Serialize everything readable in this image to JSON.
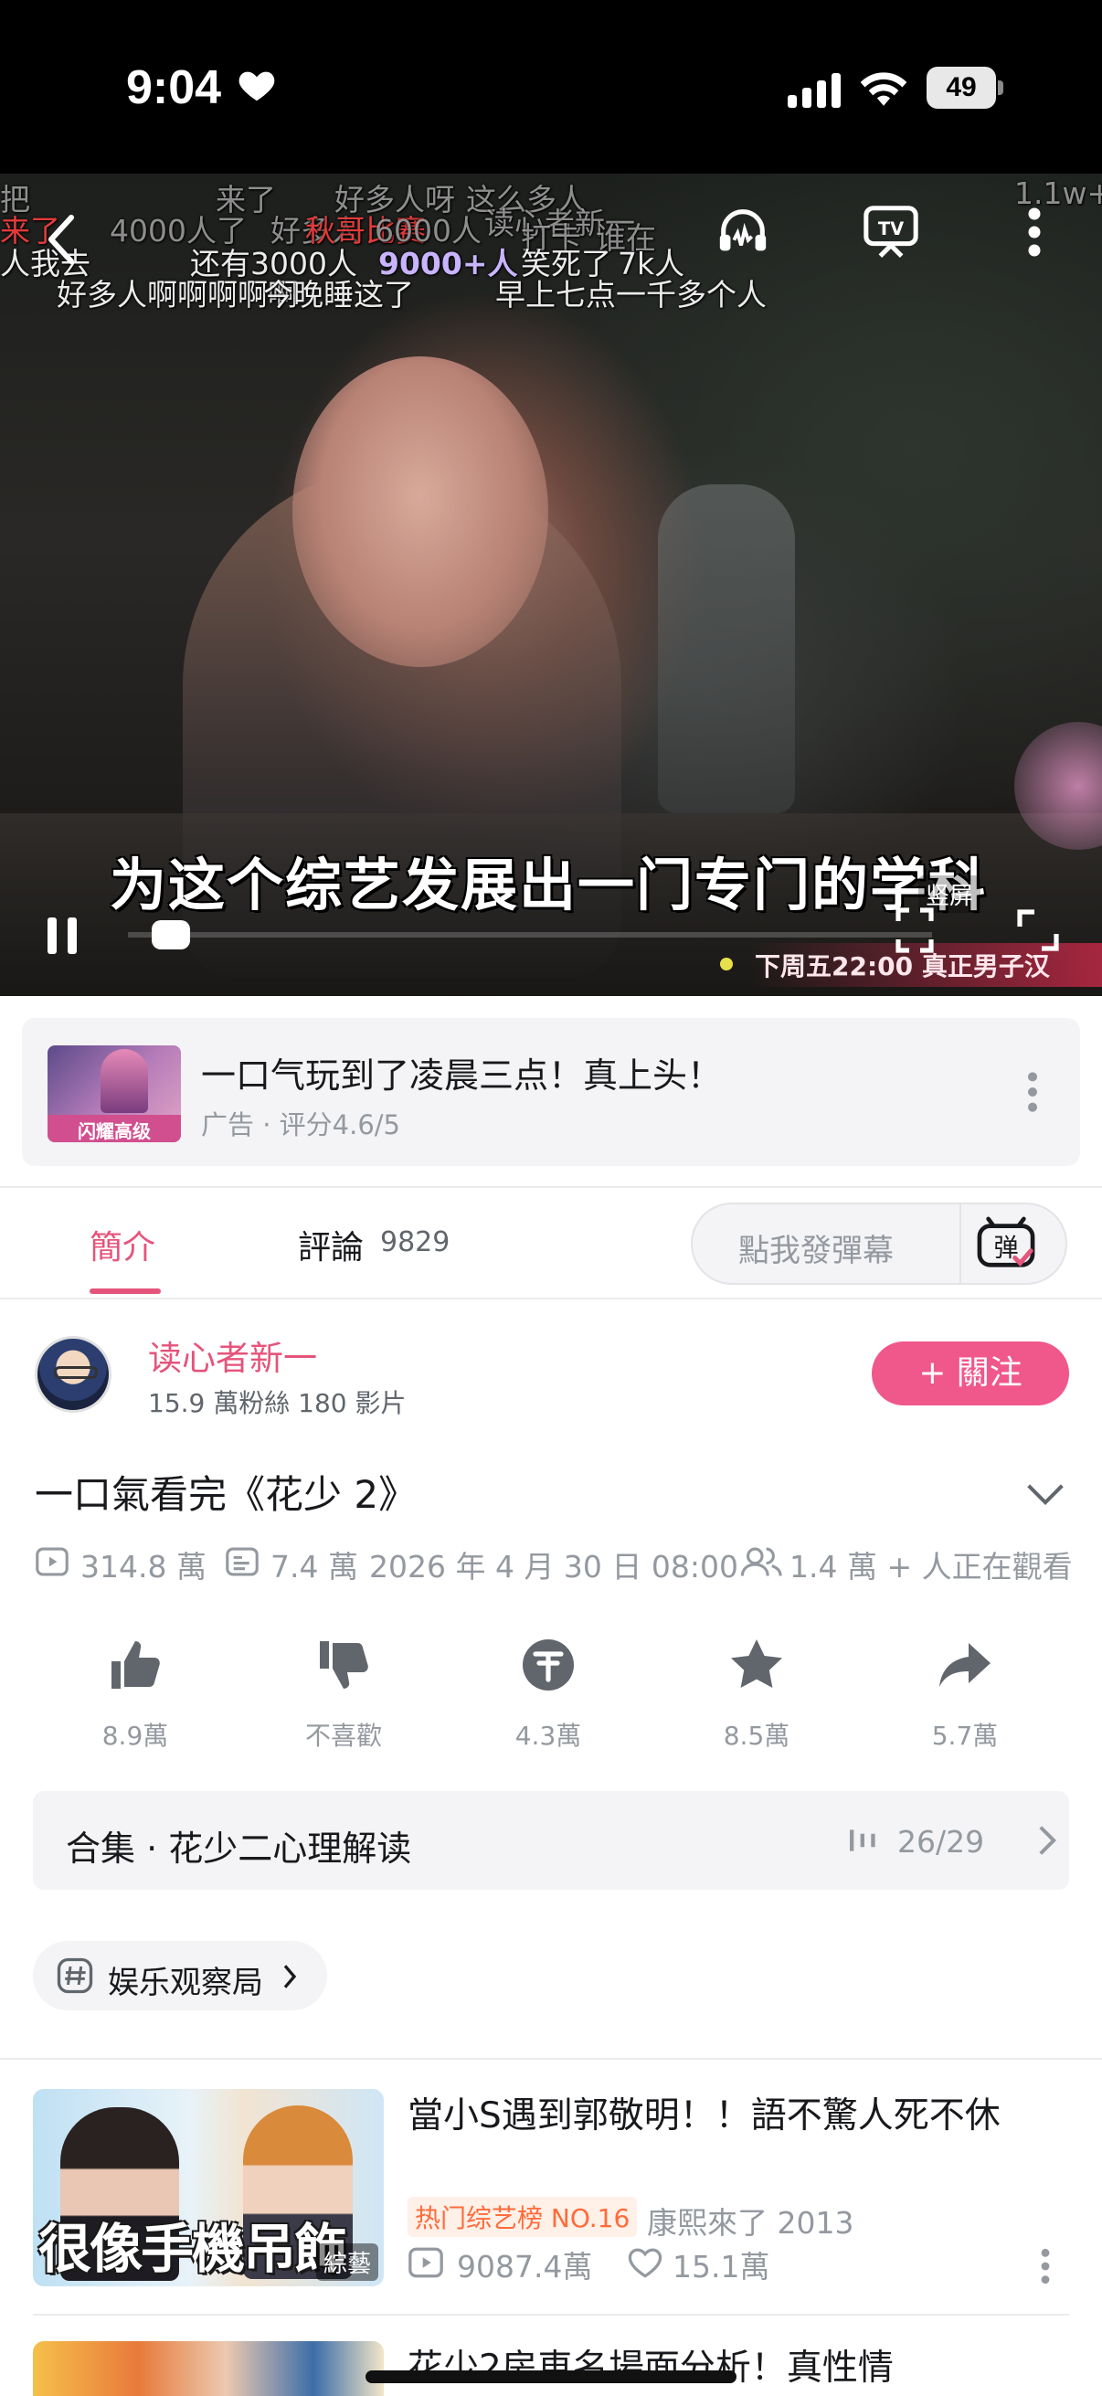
{
  "status_bar": {
    "time": "9:04",
    "battery": "49"
  },
  "player": {
    "danmaku": [
      {
        "text": "把",
        "style": "dim"
      },
      {
        "text": "来了",
        "style": "dim"
      },
      {
        "text": "好多人呀",
        "style": "dim"
      },
      {
        "text": "这么多人",
        "style": "dim"
      },
      {
        "text": "1.1w+",
        "style": "dim"
      },
      {
        "text": "来了",
        "style": "red"
      },
      {
        "text": "4000人了",
        "style": "dim"
      },
      {
        "text": "好多人",
        "style": "dim"
      },
      {
        "text": "秋哥比赛",
        "style": "red"
      },
      {
        "text": "6000人",
        "style": "dim"
      },
      {
        "text": "读心者新一",
        "style": "dim"
      },
      {
        "text": "打卡",
        "style": "dim"
      },
      {
        "text": "谁在",
        "style": "dim"
      },
      {
        "text": "人我去",
        "style": "normal"
      },
      {
        "text": "还有3000人",
        "style": "normal"
      },
      {
        "text": "9000+人",
        "style": "purple"
      },
      {
        "text": "笑死了",
        "style": "normal"
      },
      {
        "text": "7k人",
        "style": "normal"
      },
      {
        "text": "好多人啊啊啊啊啊",
        "style": "normal"
      },
      {
        "text": "今晚睡这了",
        "style": "normal"
      },
      {
        "text": "早上七点一千多个人",
        "style": "normal"
      }
    ],
    "subtitle": "为这个综艺发展出一门专门的学科",
    "portrait_label": "竖屏",
    "ad_banner": "下周五22:00 真正男子汉",
    "progress": 0.03
  },
  "ad": {
    "thumb_label": "闪耀高级",
    "title": "一口气玩到了凌晨三点！真上头！",
    "meta": "广告 · 评分4.6/5"
  },
  "tabs": {
    "intro": "簡介",
    "comments": "評論",
    "comments_count": "9829",
    "danmaku_placeholder": "點我發彈幕",
    "danmaku_icon_char": "弹"
  },
  "uploader": {
    "name": "读心者新一",
    "stats": "15.9 萬粉絲   180 影片",
    "follow_label": "+ 關注"
  },
  "video": {
    "title": "一口氣看完《花少 2》",
    "views": "314.8 萬",
    "danmaku_count": "7.4 萬",
    "date": "2026 年 4 月 30 日 08:00",
    "watching": "1.4 萬 + 人正在觀看"
  },
  "actions": {
    "like": "8.9萬",
    "dislike": "不喜歡",
    "coin": "4.3萬",
    "favorite": "8.5萬",
    "share": "5.7萬"
  },
  "collection": {
    "title": "合集 · 花少二心理解读",
    "progress": "26/29"
  },
  "tag": {
    "label": "娱乐观察局"
  },
  "related": [
    {
      "title": "當小S遇到郭敬明！！語不驚人死不休",
      "thumb_caption": "很像手機吊飾",
      "thumb_badge": "綜藝",
      "rank_tag": "热门综艺榜 NO.16",
      "source": "康熙來了 2013",
      "views": "9087.4萬",
      "likes": "15.1萬"
    },
    {
      "title": "花少2房車名場面分析！真性情"
    }
  ]
}
